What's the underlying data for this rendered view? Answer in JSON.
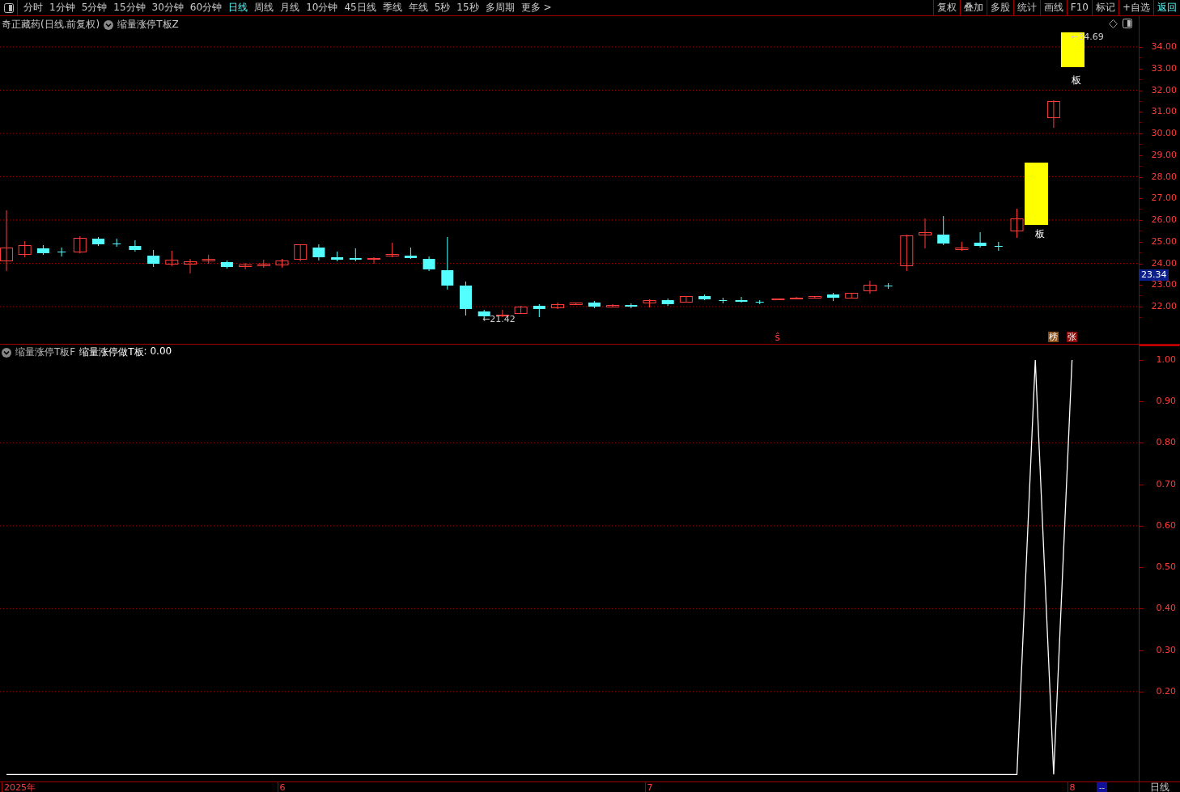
{
  "toolbar": {
    "tabs": [
      {
        "label": "分时",
        "selected": false
      },
      {
        "label": "1分钟",
        "selected": false
      },
      {
        "label": "5分钟",
        "selected": false
      },
      {
        "label": "15分钟",
        "selected": false
      },
      {
        "label": "30分钟",
        "selected": false
      },
      {
        "label": "60分钟",
        "selected": false
      },
      {
        "label": "日线",
        "selected": true
      },
      {
        "label": "周线",
        "selected": false
      },
      {
        "label": "月线",
        "selected": false
      },
      {
        "label": "10分钟",
        "selected": false
      },
      {
        "label": "45日线",
        "selected": false
      },
      {
        "label": "季线",
        "selected": false
      },
      {
        "label": "年线",
        "selected": false
      },
      {
        "label": "5秒",
        "selected": false
      },
      {
        "label": "15秒",
        "selected": false
      },
      {
        "label": "多周期",
        "selected": false
      },
      {
        "label": "更多 >",
        "selected": false
      }
    ],
    "buttons": [
      {
        "label": "复权",
        "kind": "button"
      },
      {
        "label": "叠加",
        "kind": "button"
      },
      {
        "label": "多股",
        "kind": "button"
      },
      {
        "label": "统计",
        "kind": "button"
      },
      {
        "label": "画线",
        "kind": "button"
      },
      {
        "label": "F10",
        "kind": "button"
      },
      {
        "label": "标记",
        "kind": "button"
      },
      {
        "label": "+自选",
        "kind": "button"
      },
      {
        "label": "返回",
        "kind": "link"
      }
    ]
  },
  "price_chart": {
    "title": "奇正藏药(日线.前复权)",
    "formula": "缩量涨停T板Z",
    "axis_labels": [
      "34.00",
      "33.00",
      "32.00",
      "31.00",
      "30.00",
      "29.00",
      "28.00",
      "27.00",
      "26.00",
      "25.00",
      "24.00",
      "23.00",
      "22.00"
    ],
    "current_price": "23.34",
    "high_label": "←34.69",
    "low_label": "←21.42",
    "board_labels": [
      "板",
      "板"
    ],
    "signal": "ŝ",
    "tags": [
      {
        "text": "榜",
        "color": "#8a4a10"
      },
      {
        "text": "张",
        "color": "#8c0a0a"
      }
    ]
  },
  "indicator": {
    "title": "缩量涨停T板F",
    "reading": ": 0.00",
    "chart_data": {
      "type": "line",
      "series": [
        {
          "name": "缩量涨停做T板",
          "color": "#ffffff",
          "values": [
            0,
            0,
            0,
            0,
            0,
            0,
            0,
            0,
            0,
            0,
            0,
            0,
            0,
            0,
            0,
            0,
            0,
            0,
            0,
            0,
            0,
            0,
            0,
            0,
            0,
            0,
            0,
            0,
            0,
            0,
            0,
            0,
            0,
            0,
            0,
            0,
            0,
            0,
            0,
            0,
            0,
            0,
            0,
            0,
            0,
            0,
            0,
            0,
            0,
            0,
            0,
            0,
            0,
            0,
            0,
            0,
            1,
            0,
            1
          ]
        }
      ],
      "ylim": [
        -0.017,
        1.037
      ],
      "grid": true,
      "yticks": [
        {
          "value": 1,
          "label": "1.00"
        },
        {
          "value": 0.9,
          "label": "0.90"
        },
        {
          "value": 0.8,
          "label": "0.80"
        },
        {
          "value": 0.7,
          "label": "0.70"
        },
        {
          "value": 0.6,
          "label": "0.60"
        },
        {
          "value": 0.5,
          "label": "0.50"
        },
        {
          "value": 0.4,
          "label": "0.40"
        },
        {
          "value": 0.3,
          "label": "0.30"
        },
        {
          "value": 0.2,
          "label": "0.20"
        }
      ]
    }
  },
  "date_axis": {
    "labels": [
      "2025年",
      "6",
      "7",
      "8"
    ],
    "cursor": "--",
    "period": "日线"
  }
}
